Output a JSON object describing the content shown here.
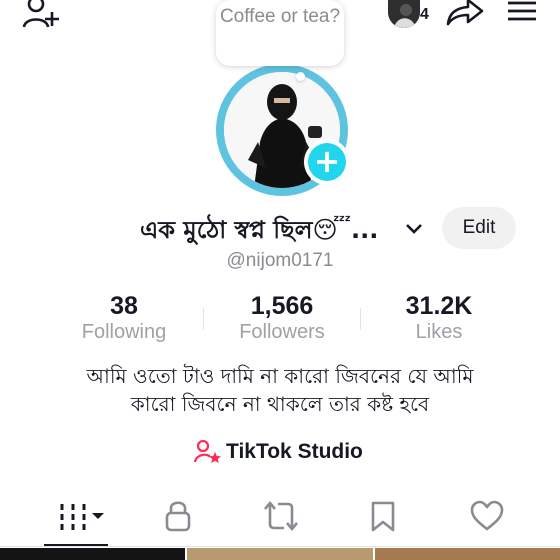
{
  "header": {
    "add_friend_icon": "person-plus-icon",
    "notification_count": "4",
    "share_icon": "share-arrow-icon",
    "menu_icon": "hamburger-menu-icon"
  },
  "note_bubble": {
    "text": "Coffee or tea?"
  },
  "profile": {
    "display_name": "এক মুঠো স্বপ্ন ছিল😴...",
    "username": "@nijom0171",
    "edit_label": "Edit"
  },
  "stats": [
    {
      "value": "38",
      "label": "Following"
    },
    {
      "value": "1,566",
      "label": "Followers"
    },
    {
      "value": "31.2K",
      "label": "Likes"
    }
  ],
  "bio": {
    "line1": "আমি ওতো টাও দামি না কারো জিবনের যে আমি",
    "line2": "কারো  জিবনে না থাকলে তার কষ্ট হবে"
  },
  "studio": {
    "label": "TikTok Studio"
  },
  "colors": {
    "accent_cyan": "#20d5ec",
    "studio_pink": "#fe2c55",
    "text_primary": "#161823",
    "text_secondary": "#8a8b91"
  },
  "tabs": [
    {
      "icon": "grid-videos-icon"
    },
    {
      "icon": "lock-icon"
    },
    {
      "icon": "repost-icon"
    },
    {
      "icon": "bookmark-icon"
    },
    {
      "icon": "heart-icon"
    }
  ]
}
